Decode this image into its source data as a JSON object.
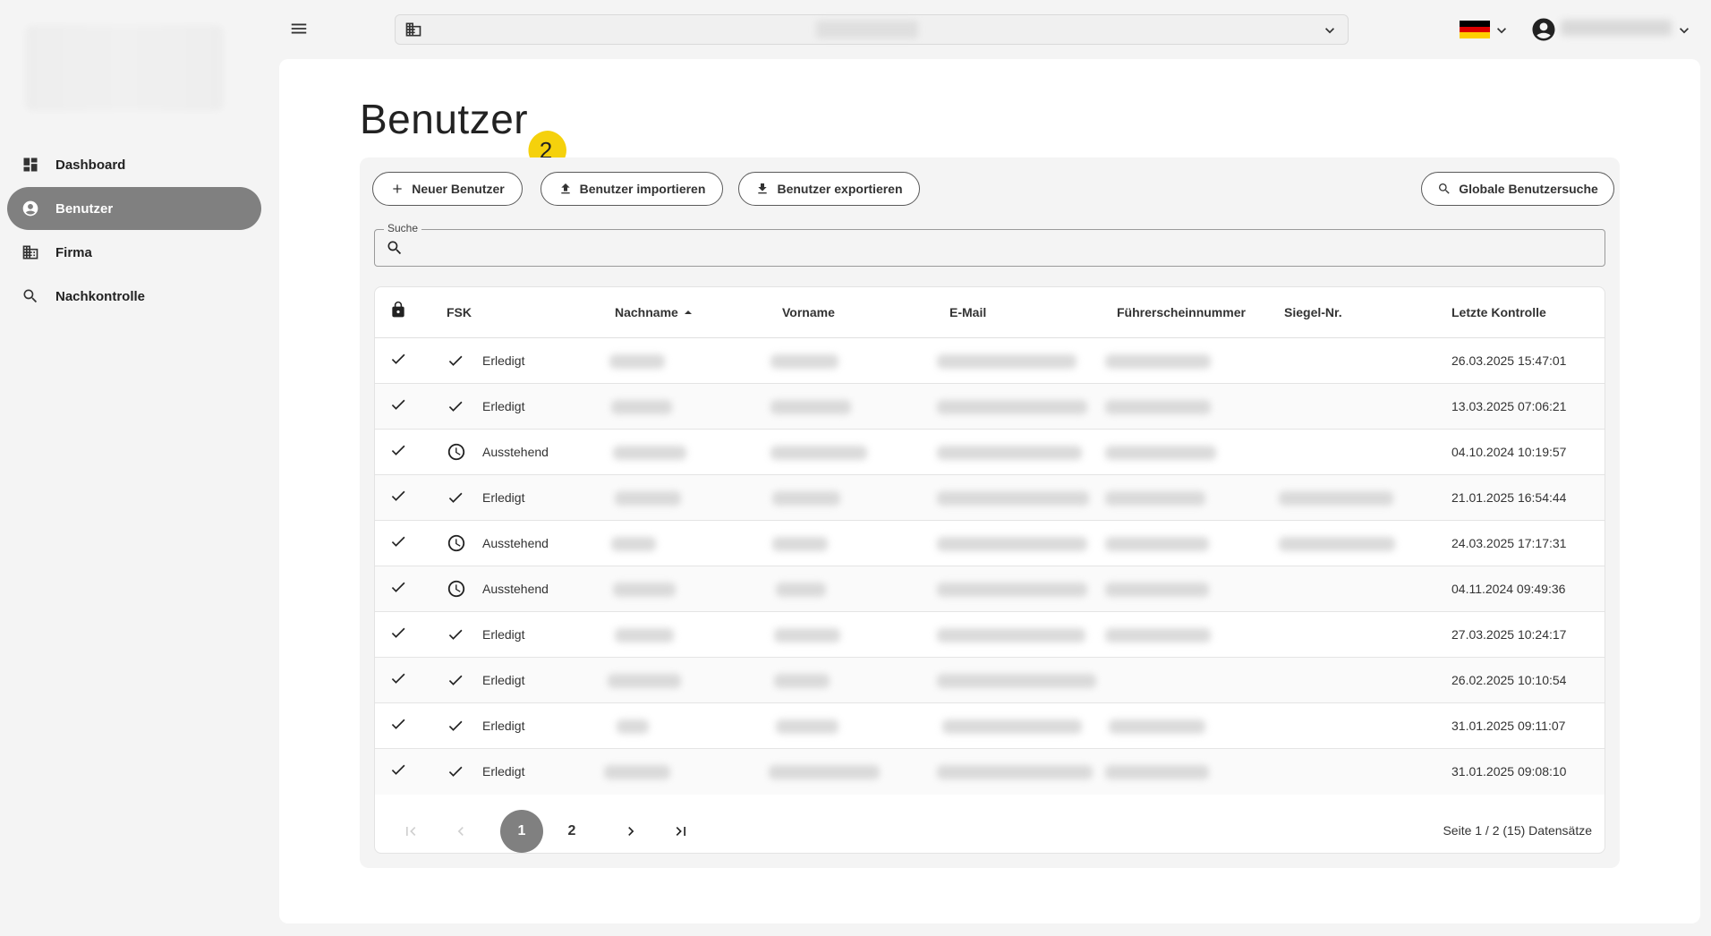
{
  "sidebar": {
    "items": [
      {
        "label": "Dashboard",
        "icon": "dashboard-icon"
      },
      {
        "label": "Benutzer",
        "icon": "account-circle-icon",
        "active": true
      },
      {
        "label": "Firma",
        "icon": "building-icon"
      },
      {
        "label": "Nachkontrolle",
        "icon": "search-icon"
      }
    ]
  },
  "topbar": {
    "flag_colors": [
      "#000000",
      "#dd0000",
      "#ffce00"
    ]
  },
  "page": {
    "title": "Benutzer",
    "callout_number": "2",
    "callout_color": "#f5d10c"
  },
  "toolbar": {
    "new_user": "Neuer Benutzer",
    "import_users": "Benutzer importieren",
    "export_users": "Benutzer exportieren",
    "global_search": "Globale Benutzersuche"
  },
  "search": {
    "label": "Suche",
    "value": ""
  },
  "table": {
    "columns": [
      "FSK",
      "Nachname",
      "Vorname",
      "E-Mail",
      "Führerscheinnummer",
      "Siegel-Nr.",
      "Letzte Kontrolle"
    ],
    "sort_column": "Nachname",
    "sort_direction": "asc",
    "rows": [
      {
        "fsk": "Erledigt",
        "status_icon": "check-icon",
        "last_check": "26.03.2025 15:47:01"
      },
      {
        "fsk": "Erledigt",
        "status_icon": "check-icon",
        "last_check": "13.03.2025 07:06:21"
      },
      {
        "fsk": "Ausstehend",
        "status_icon": "clock-icon",
        "last_check": "04.10.2024 10:19:57"
      },
      {
        "fsk": "Erledigt",
        "status_icon": "check-icon",
        "last_check": "21.01.2025 16:54:44"
      },
      {
        "fsk": "Ausstehend",
        "status_icon": "clock-icon",
        "last_check": "24.03.2025 17:17:31"
      },
      {
        "fsk": "Ausstehend",
        "status_icon": "clock-icon",
        "last_check": "04.11.2024 09:49:36"
      },
      {
        "fsk": "Erledigt",
        "status_icon": "check-icon",
        "last_check": "27.03.2025 10:24:17"
      },
      {
        "fsk": "Erledigt",
        "status_icon": "check-icon",
        "last_check": "26.02.2025 10:10:54"
      },
      {
        "fsk": "Erledigt",
        "status_icon": "check-icon",
        "last_check": "31.01.2025 09:11:07"
      },
      {
        "fsk": "Erledigt",
        "status_icon": "check-icon",
        "last_check": "31.01.2025 09:08:10"
      }
    ]
  },
  "pagination": {
    "pages": [
      "1",
      "2"
    ],
    "current": "1",
    "info": "Seite 1 / 2 (15) Datensätze"
  }
}
